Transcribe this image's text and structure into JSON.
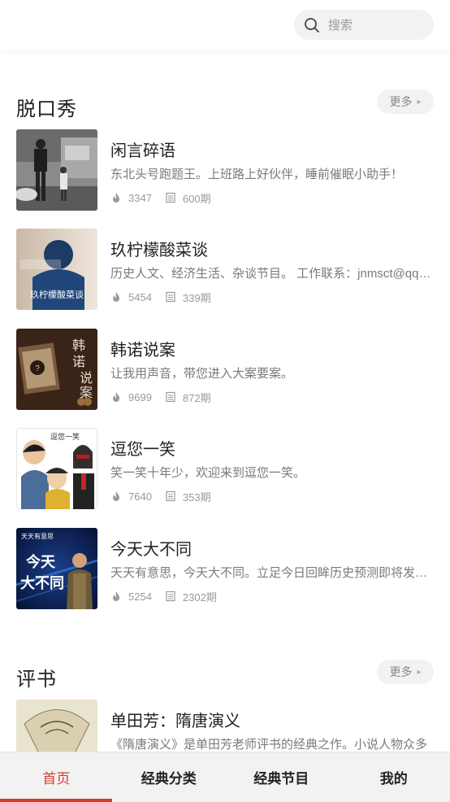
{
  "search": {
    "placeholder": "搜索"
  },
  "sections": [
    {
      "title": "脱口秀",
      "more_label": "更多",
      "items": [
        {
          "title": "闲言碎语",
          "desc": "东北头号跑题王。上班路上好伙伴，睡前催眠小助手！",
          "plays": "3347",
          "episodes": "600期"
        },
        {
          "title": "玖柠檬酸菜谈",
          "desc": "历史人文、经济生活、杂谈节目。 工作联系：jnmsct@qq.com",
          "plays": "5454",
          "episodes": "339期",
          "cover_text": "玖柠檬酸菜谈"
        },
        {
          "title": "韩诺说案",
          "desc": "让我用声音，带您进入大案要案。",
          "plays": "9699",
          "episodes": "872期",
          "cover_text": "韩诺说案"
        },
        {
          "title": "逗您一笑",
          "desc": "笑一笑十年少，欢迎来到逗您一笑。",
          "plays": "7640",
          "episodes": "353期",
          "cover_text": "逗您一笑"
        },
        {
          "title": "今天大不同",
          "desc": "天天有意思，今天大不同。立足今日回眸历史预测即将发生的事",
          "plays": "5254",
          "episodes": "2302期",
          "cover_text_top": "天天有意思",
          "cover_text_main1": "今天",
          "cover_text_main2": "大不同"
        }
      ]
    },
    {
      "title": "评书",
      "more_label": "更多",
      "items": [
        {
          "title": "单田芳：隋唐演义",
          "desc": "《隋唐演义》是单田芳老师评书的经典之作。小说人物众多",
          "plays": "",
          "episodes": ""
        }
      ]
    }
  ],
  "tabs": [
    {
      "label": "首页",
      "active": true
    },
    {
      "label": "经典分类",
      "active": false
    },
    {
      "label": "经典节目",
      "active": false
    },
    {
      "label": "我的",
      "active": false
    }
  ],
  "colors": {
    "accent": "#d63a2a",
    "tab_bg": "#f2f2f2",
    "muted": "#9a9a9a"
  }
}
